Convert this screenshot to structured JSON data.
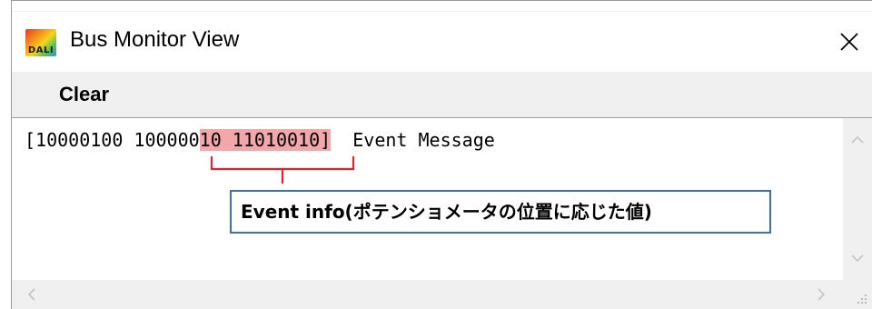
{
  "window": {
    "title": "Bus Monitor View",
    "icon_label": "DALI",
    "icon_name": "dali-app-icon",
    "close_icon": "close-icon"
  },
  "toolbar": {
    "clear_label": "Clear"
  },
  "monitor": {
    "log_line": {
      "prefix": "[10000100 100000",
      "highlight": "10 11010010]",
      "suffix": "  Event Message"
    },
    "annotation": "Event info(ポテンショメータの位置に応じた値)"
  },
  "colors": {
    "highlight": "#f3a7ab",
    "brace": "#e8202a",
    "callout_border": "#3b6fb6",
    "window_bg": "#f0f0f0"
  }
}
